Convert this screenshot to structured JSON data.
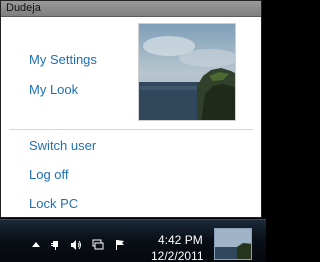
{
  "window": {
    "title": "Dudeja"
  },
  "menu": {
    "my_settings": "My Settings",
    "my_look": "My Look",
    "switch_user": "Switch user",
    "log_off": "Log off",
    "lock_pc": "Lock PC"
  },
  "photo": {
    "icon": "landscape-photo"
  },
  "taskbar": {
    "time": "4:42 PM",
    "date": "12/2/2011",
    "tray_icons": [
      "show-hidden-icons-arrow",
      "power-plug-icon",
      "volume-icon",
      "network-icon",
      "action-center-flag-icon"
    ]
  },
  "colors": {
    "link": "#1f6fb8",
    "title_bar": "#8c8c8c",
    "taskbar": "#0a1018"
  }
}
